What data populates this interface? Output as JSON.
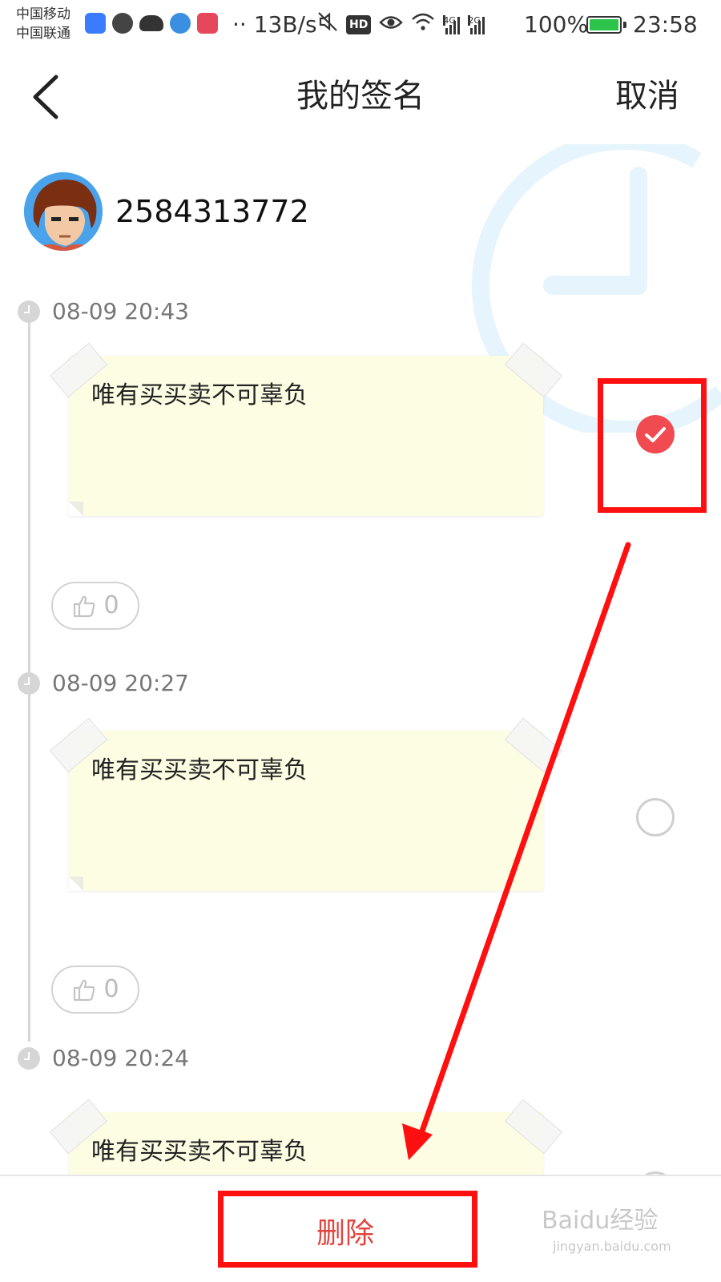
{
  "status_bar": {
    "carrier_1": "中国移动",
    "carrier_2": "中国联通",
    "left_icons": [
      "baidu-app-icon",
      "globe-icon",
      "cloud-icon",
      "browser-icon",
      "app-icon"
    ],
    "network_speed": "·· 13B/s",
    "right_icons": [
      "mute-icon",
      "hd-icon",
      "eye-icon",
      "wifi-icon",
      "signal-4g-icon",
      "signal-2g-icon"
    ],
    "hd_label": "HD",
    "signal_4g_label": "4G",
    "signal_2g_label": "2G",
    "battery_percent": "100%",
    "battery_level": 1.0,
    "battery_color": "#2cc44a",
    "time": "23:58"
  },
  "header": {
    "back_icon": "chevron-left-icon",
    "title": "我的签名",
    "cancel_label": "取消"
  },
  "profile": {
    "user_id": "2584313772"
  },
  "entries": [
    {
      "timestamp": "08-09 20:43",
      "text": "唯有买买卖不可辜负",
      "selected": true,
      "likes": "0"
    },
    {
      "timestamp": "08-09 20:27",
      "text": "唯有买买卖不可辜负",
      "selected": false,
      "likes": "0"
    },
    {
      "timestamp": "08-09 20:24",
      "text": "唯有买买卖不可辜负",
      "selected": false,
      "likes": ""
    }
  ],
  "bottom_bar": {
    "delete_label": "删除"
  },
  "colors": {
    "accent_red": "#f04b50",
    "delete_text": "#e0453f",
    "note_background": "#fdfde4",
    "annotation_red": "#ff1010",
    "bg_clock_blue": "#e6f4fd"
  },
  "watermark": {
    "text": "Baidu经验",
    "subtext": "jingyan.baidu.com"
  }
}
